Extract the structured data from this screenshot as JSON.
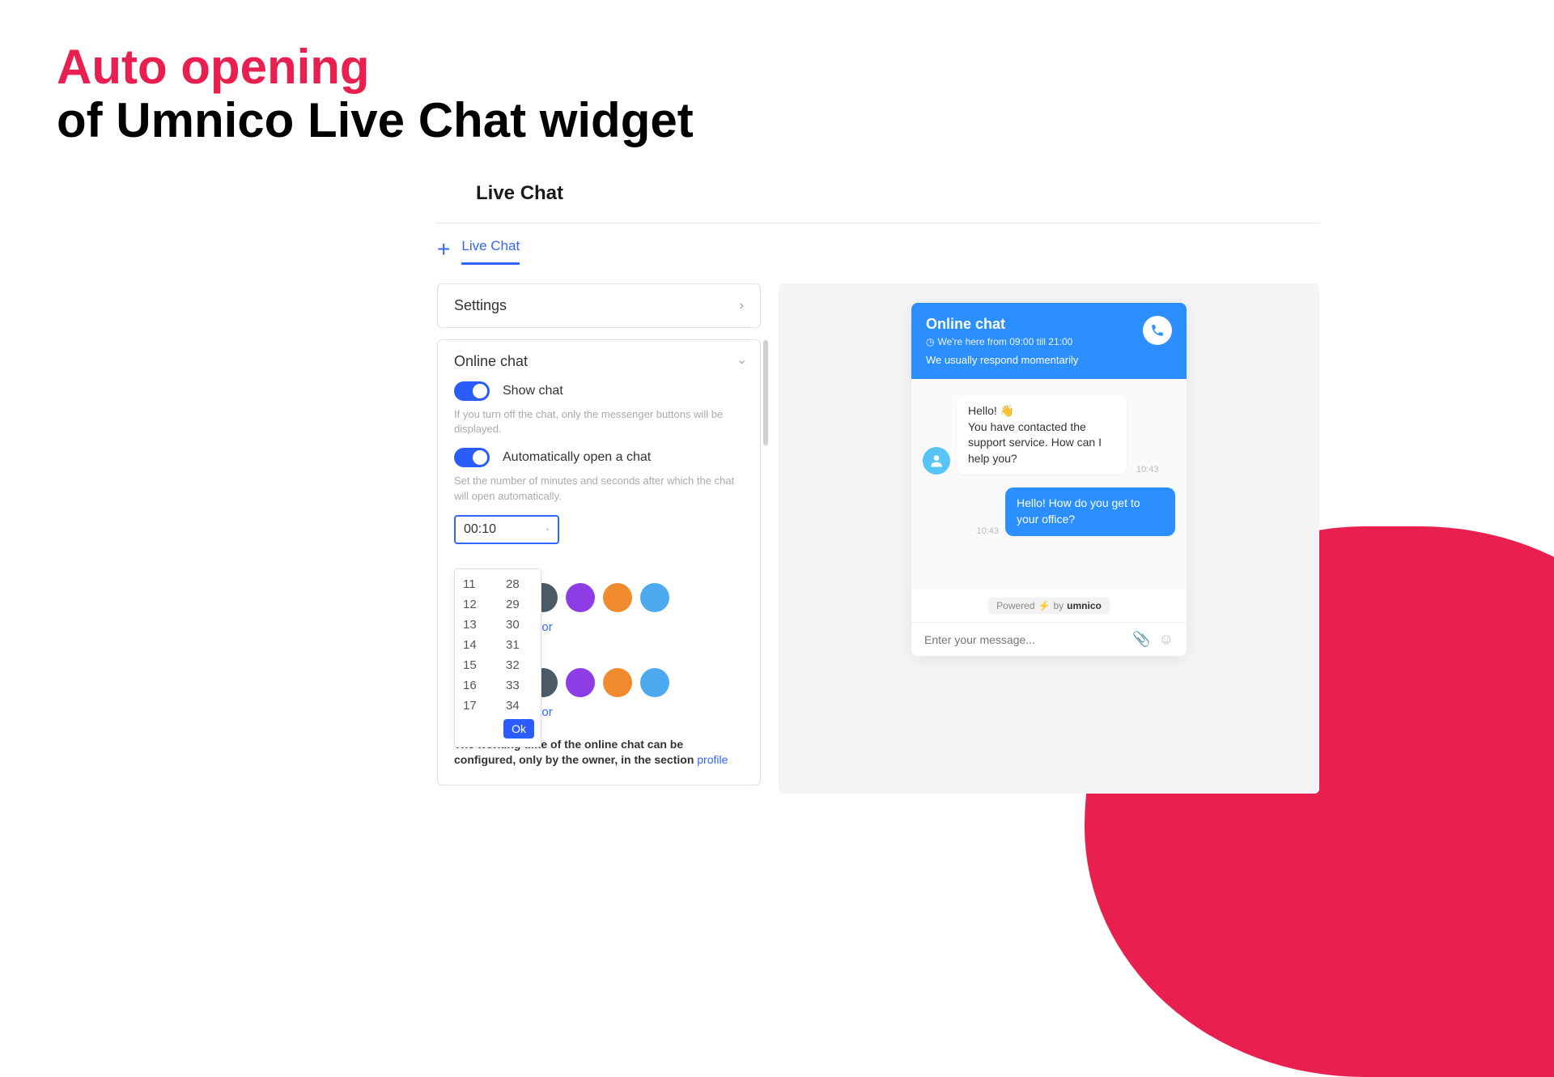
{
  "heading": {
    "accent": "Auto opening",
    "rest": "of Umnico Live Chat widget"
  },
  "app_title": "Live Chat",
  "tab_label": "Live Chat",
  "settings": {
    "label": "Settings"
  },
  "online_chat": {
    "header": "Online chat",
    "show_chat_label": "Show chat",
    "show_chat_help": "If you turn off the chat, only the messenger buttons will be displayed.",
    "auto_open_label": "Automatically open a chat",
    "auto_open_help": "Set the number of minutes and seconds after which the chat will open automatically.",
    "time_value": "00:10",
    "choose_color": "Choose your color",
    "working_time_note": "The working time of the online chat can be configured, only by the owner, in the section ",
    "profile_link": "profile"
  },
  "dropdown": {
    "left": [
      "11",
      "12",
      "13",
      "14",
      "15",
      "16",
      "17"
    ],
    "right": [
      "28",
      "29",
      "30",
      "31",
      "32",
      "33",
      "34"
    ],
    "ok": "Ok"
  },
  "colors": [
    "#14b89a",
    "#ff5a5a",
    "#4a5a66",
    "#8e3de6",
    "#f08a2c",
    "#4daaf0"
  ],
  "chat": {
    "title": "Online chat",
    "hours": "We're here from 09:00 till 21:00",
    "respond": "We usually respond momentarily",
    "msg1_line1": "Hello! 👋",
    "msg1_line2": "You have contacted the support service. How can I help you?",
    "msg1_time": "10:43",
    "msg2": "Hello! How do you get to your office?",
    "msg2_time": "10:43",
    "powered": "Powered",
    "by": "by",
    "brand": "umnico",
    "input_placeholder": "Enter your message..."
  }
}
